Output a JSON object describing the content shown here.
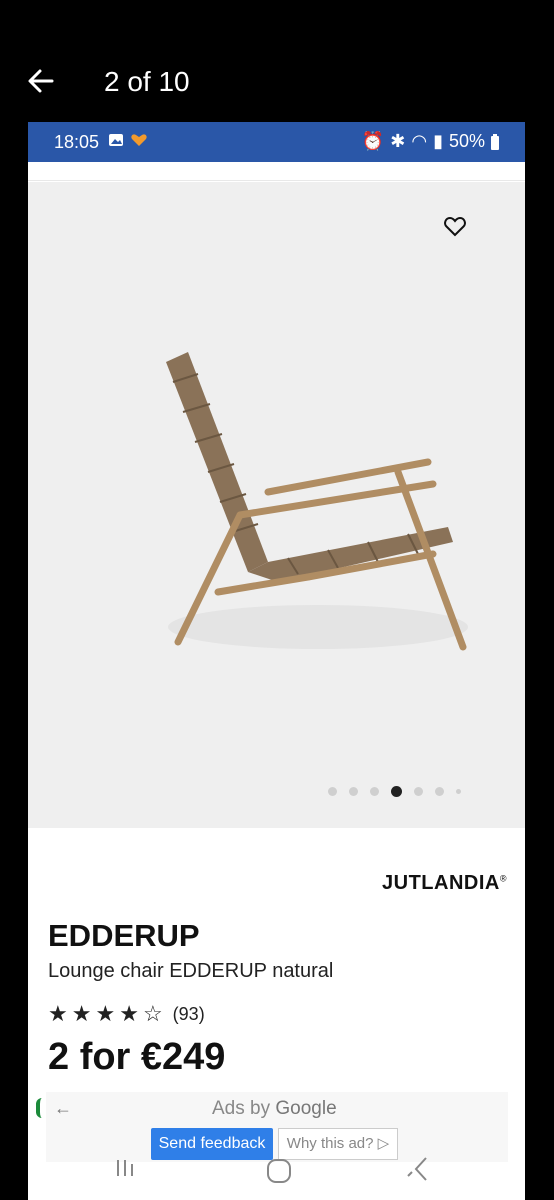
{
  "viewer": {
    "counter": "2 of 10"
  },
  "status_bar": {
    "time": "18:05",
    "battery": "50%"
  },
  "product": {
    "brand": "JUTLANDIA",
    "brand_mark": "®",
    "name": "EDDERUP",
    "description": "Lounge chair EDDERUP natural",
    "rating_stars": 4,
    "rating_max": 5,
    "review_count": "(93)",
    "price": "2 for €249",
    "gallery": {
      "total_dots": 7,
      "active_index": 3
    }
  },
  "ad": {
    "ads_by": "Ads by",
    "google": "Google",
    "send_feedback": "Send feedback",
    "why_this_ad": "Why this ad?"
  },
  "icons": {
    "back": "back-arrow-icon",
    "favorite": "heart-icon"
  },
  "colors": {
    "status_bar": "#2a57a8",
    "ad_button": "#2f7fe8"
  }
}
